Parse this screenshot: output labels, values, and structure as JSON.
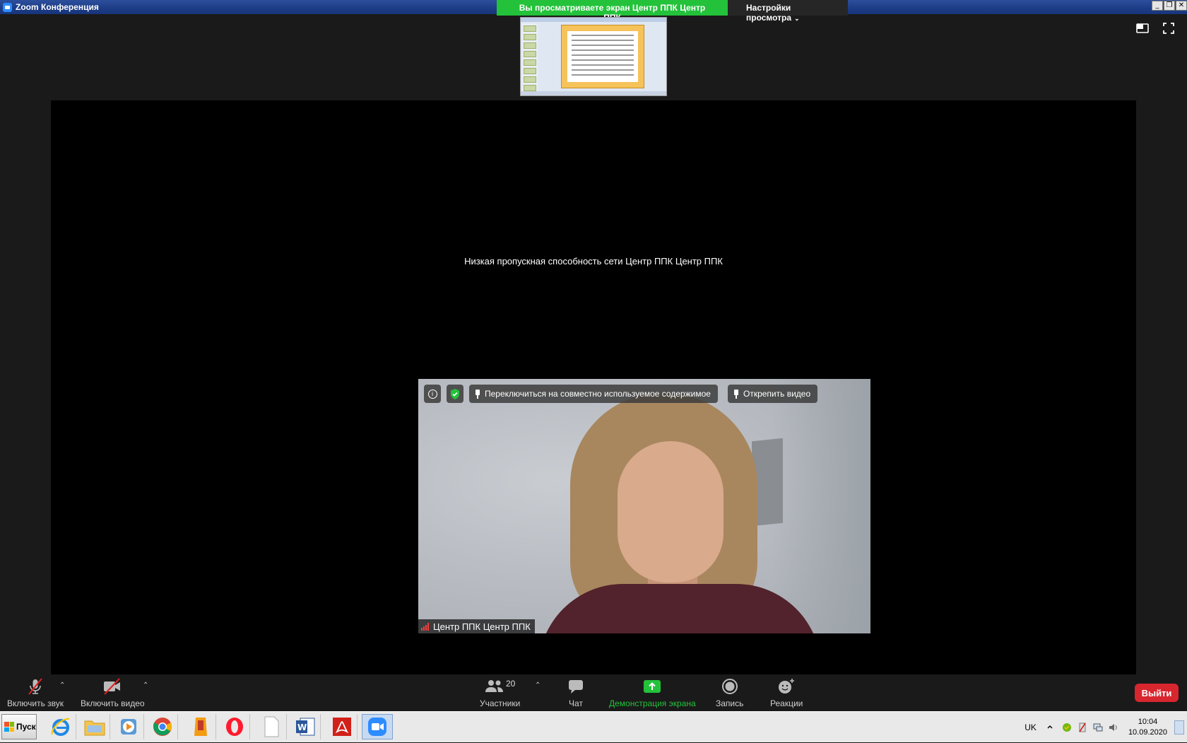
{
  "window": {
    "title": "Zoom Конференция",
    "sharing_banner": "Вы просматриваете экран Центр ППК Центр ППК",
    "view_options": "Настройки просмотра",
    "controls": {
      "minimize": "_",
      "restore": "❐",
      "close": "✕"
    }
  },
  "stage": {
    "bandwidth_notice": "Низкая пропускная способность сети Центр ППК Центр ППК"
  },
  "video": {
    "switch_label": "Переключиться на совместно используемое содержимое",
    "unpin_label": "Открепить видео",
    "participant_name": "Центр ППК Центр ППК"
  },
  "toolbar": {
    "mute_label": "Включить звук",
    "video_label": "Включить видео",
    "participants_label": "Участники",
    "participants_count": "20",
    "chat_label": "Чат",
    "share_label": "Демонстрация экрана",
    "record_label": "Запись",
    "reactions_label": "Реакции",
    "leave_label": "Выйти",
    "share_color": "#23c23a",
    "leave_color": "#d8262f"
  },
  "taskbar": {
    "start_label": "Пуск",
    "language": "UK",
    "time": "10:04",
    "date": "10.09.2020",
    "apps": [
      "internet-explorer-icon",
      "file-explorer-icon",
      "media-player-icon",
      "chrome-icon",
      "app-icon",
      "opera-icon",
      "blank-document-icon",
      "word-icon",
      "acrobat-icon",
      "zoom-icon"
    ]
  }
}
